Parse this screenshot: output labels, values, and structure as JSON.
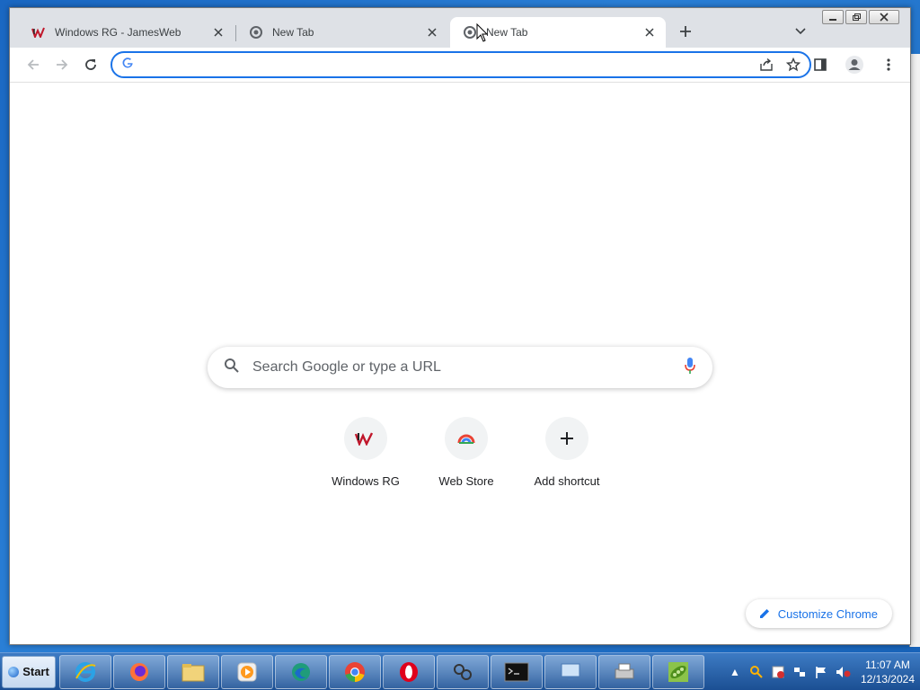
{
  "browser": {
    "tabs": [
      {
        "title": "Windows RG - JamesWeb",
        "favicon": "jw-logo-icon",
        "active": false
      },
      {
        "title": "New Tab",
        "favicon": "chrome-icon",
        "active": false
      },
      {
        "title": "New Tab",
        "favicon": "chrome-icon",
        "active": true
      }
    ],
    "omnibox": {
      "value": "",
      "placeholder": ""
    }
  },
  "ntp": {
    "search_placeholder": "Search Google or type a URL",
    "shortcuts": [
      {
        "label": "Windows RG",
        "icon": "jw-logo-icon"
      },
      {
        "label": "Web Store",
        "icon": "webstore-icon"
      },
      {
        "label": "Add shortcut",
        "icon": "plus-icon"
      }
    ],
    "customize_label": "Customize Chrome"
  },
  "taskbar": {
    "start_label": "Start",
    "clock_time": "11:07 AM",
    "clock_date": "12/13/2024"
  },
  "colors": {
    "accent": "#1a73e8",
    "taskbar": "#1b4f93"
  }
}
